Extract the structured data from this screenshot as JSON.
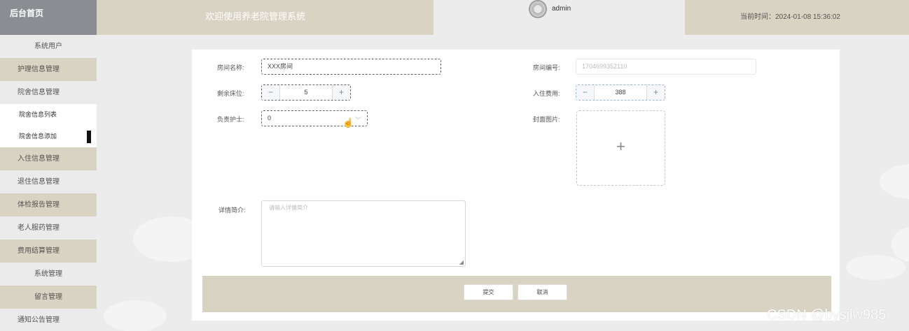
{
  "header": {
    "brand": "后台首页",
    "title": "欢迎使用养老院管理系统",
    "username": "admin",
    "time_text": "当前时间：2024-01-08 15:36:02"
  },
  "sidebar": {
    "items": [
      {
        "label": "系统用户"
      },
      {
        "label": "护理信息管理"
      },
      {
        "label": "院舍信息管理"
      },
      {
        "label": "院舍信息列表"
      },
      {
        "label": "院舍信息添加"
      },
      {
        "label": "入住信息管理"
      },
      {
        "label": "退住信息管理"
      },
      {
        "label": "体检报告管理"
      },
      {
        "label": "老人服药管理"
      },
      {
        "label": "费用结算管理"
      },
      {
        "label": "系统管理"
      },
      {
        "label": "留言管理"
      },
      {
        "label": "通知公告管理"
      }
    ]
  },
  "form": {
    "room_name_label": "房间名称:",
    "room_name_value": "XXX房间",
    "room_no_label": "房间编号:",
    "room_no_value": "1704699352110",
    "beds_label": "剩余床位:",
    "beds_value": "5",
    "fee_label": "入住费用:",
    "fee_value": "388",
    "nurse_label": "负责护士:",
    "nurse_value": "0",
    "cover_label": "封面图片:",
    "detail_label": "详情简介:",
    "detail_placeholder": "请输入详情简介",
    "minus": "−",
    "plus": "+",
    "chevron": "﹀",
    "upload_plus": "+",
    "submit": "提交",
    "cancel": "取消"
  },
  "watermark": "CSDN @bysjlw985"
}
